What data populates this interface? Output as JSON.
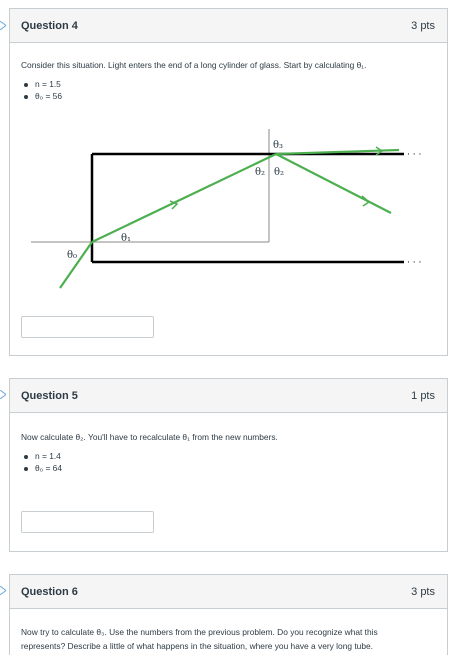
{
  "questions": [
    {
      "title": "Question 4",
      "points": "3 pts",
      "prompt": "Consider this situation. Light enters the end of a long cylinder of glass. Start by calculating θ₁.",
      "values": [
        "n = 1.5",
        "θ₀ = 56"
      ]
    },
    {
      "title": "Question 5",
      "points": "1 pts",
      "prompt": "Now calculate θ₂. You'll have to recalculate θ₁ from the new numbers.",
      "values": [
        "n = 1.4",
        "θ₀ = 64"
      ]
    },
    {
      "title": "Question 6",
      "points": "3 pts",
      "prompt_line1": "Now try to calculate θ₃. Use the numbers from the previous problem. Do you recognize what this",
      "prompt_line2": "represents? Describe a little of what happens in the situation, where you have a very long tube."
    }
  ],
  "diagram": {
    "labels": {
      "theta0": "θ₀",
      "theta1": "θ₁",
      "theta2_left": "θ₂",
      "theta2_right": "θ₂",
      "theta3": "θ₃",
      "ellipsis_top": "· · ·",
      "ellipsis_bottom": "· · ·"
    },
    "colors": {
      "ray": "#4caf50",
      "glass": "#000000",
      "normal": "#888888"
    }
  },
  "icons": {
    "question_marker": "chevron-right-icon"
  }
}
